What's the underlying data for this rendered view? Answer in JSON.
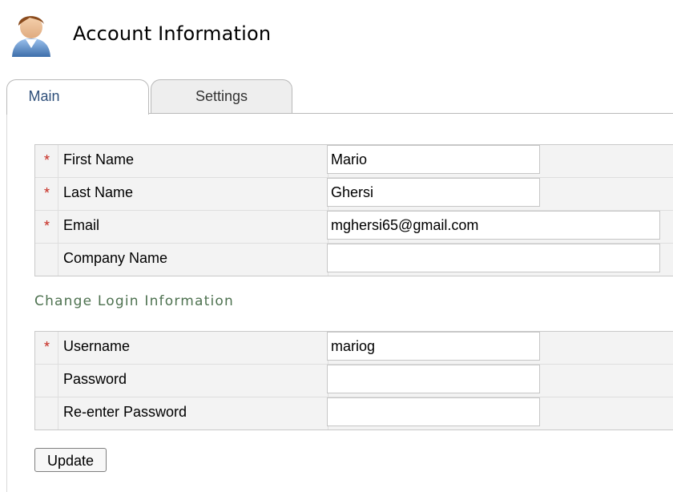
{
  "header": {
    "title": "Account Information",
    "icon": "user-avatar-icon"
  },
  "tabs": [
    {
      "label": "Main",
      "active": true
    },
    {
      "label": "Settings",
      "active": false
    }
  ],
  "account_fields": [
    {
      "label": "First Name",
      "required": true,
      "value": "Mario",
      "placeholder": ""
    },
    {
      "label": "Last Name",
      "required": true,
      "value": "Ghersi",
      "placeholder": ""
    },
    {
      "label": "Email",
      "required": true,
      "value": "mghersi65@gmail.com",
      "placeholder": ""
    },
    {
      "label": "Company Name",
      "required": false,
      "value": "",
      "placeholder": ""
    }
  ],
  "login_section": {
    "title": "Change Login Information",
    "fields": [
      {
        "label": "Username",
        "required": true,
        "value": "mariog",
        "placeholder": ""
      },
      {
        "label": "Password",
        "required": false,
        "value": "",
        "placeholder": ""
      },
      {
        "label": "Re-enter Password",
        "required": false,
        "value": "",
        "placeholder": ""
      }
    ]
  },
  "required_marker": "*",
  "actions": {
    "update_label": "Update"
  },
  "colors": {
    "required": "#c62a20",
    "section_title": "#4e7250",
    "active_tab_text": "#2e4f7a"
  }
}
